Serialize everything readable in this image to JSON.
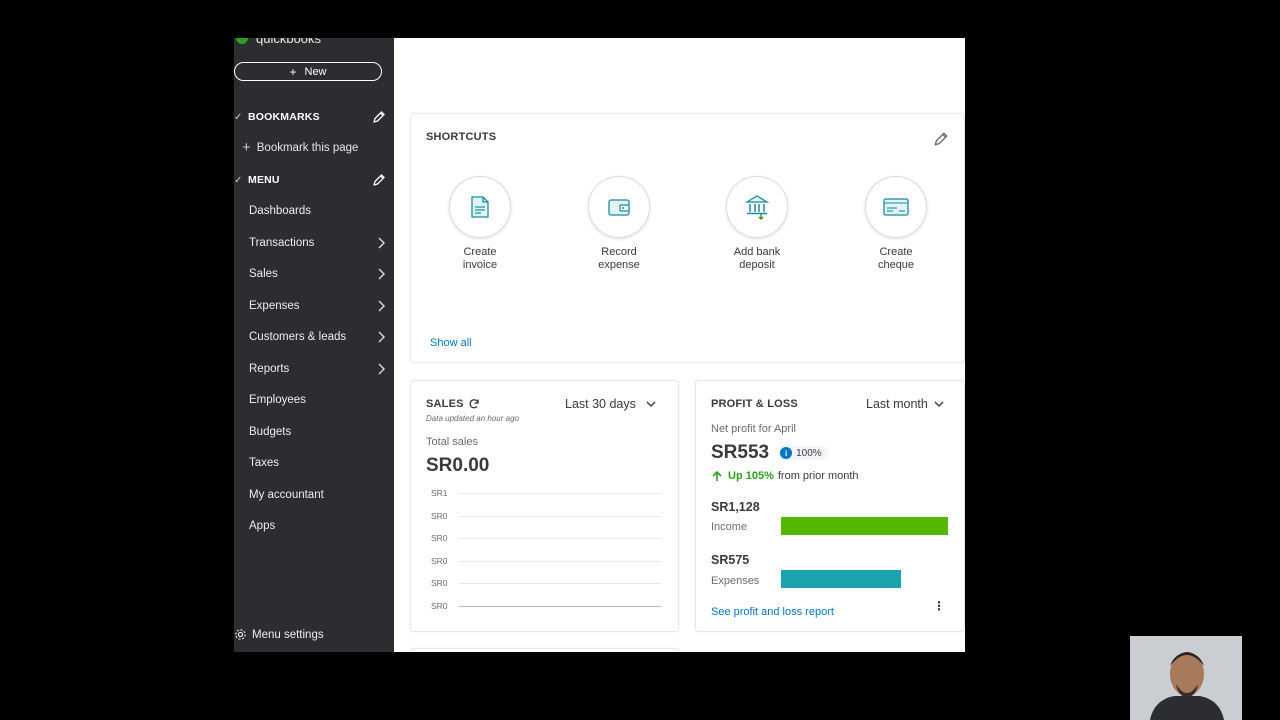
{
  "sidebar": {
    "logo": "quickbooks",
    "new_label": "New",
    "bookmarks_label": "BOOKMARKS",
    "bookmark_this_page": "Bookmark this page",
    "menu_label": "MENU",
    "items": [
      {
        "label": "Dashboards",
        "chevron": false
      },
      {
        "label": "Transactions",
        "chevron": true
      },
      {
        "label": "Sales",
        "chevron": true
      },
      {
        "label": "Expenses",
        "chevron": true
      },
      {
        "label": "Customers & leads",
        "chevron": true
      },
      {
        "label": "Reports",
        "chevron": true
      },
      {
        "label": "Employees",
        "chevron": false
      },
      {
        "label": "Budgets",
        "chevron": false
      },
      {
        "label": "Taxes",
        "chevron": false
      },
      {
        "label": "My accountant",
        "chevron": false
      },
      {
        "label": "Apps",
        "chevron": false
      }
    ],
    "menu_settings": "Menu settings"
  },
  "shortcuts": {
    "title": "SHORTCUTS",
    "items": [
      {
        "label": "Create\ninvoice",
        "icon": "invoice-icon"
      },
      {
        "label": "Record\nexpense",
        "icon": "wallet-icon"
      },
      {
        "label": "Add bank\ndeposit",
        "icon": "bank-icon"
      },
      {
        "label": "Create\ncheque",
        "icon": "cheque-icon"
      }
    ],
    "show_all": "Show all"
  },
  "sales": {
    "title": "SALES",
    "updated": "Data updated an hour ago",
    "period": "Last 30 days",
    "total_label": "Total sales",
    "total_value": "SR0.00",
    "y_labels": [
      "SR1",
      "SR0",
      "SR0",
      "SR0",
      "SR0",
      "SR0"
    ]
  },
  "profit_loss": {
    "title": "PROFIT & LOSS",
    "period": "Last month",
    "net_label": "Net profit for April",
    "net_value": "SR553",
    "badge": "100%",
    "change": "Up 105%",
    "change_suffix": "from prior month",
    "income_value": "SR1,128",
    "income_label": "Income",
    "income_fraction": 1.0,
    "expenses_value": "SR575",
    "expenses_label": "Expenses",
    "expenses_fraction": 0.72,
    "report_link": "See profit and loss report",
    "colors": {
      "income": "#53b700",
      "expenses": "#1ca3b0",
      "up": "#2ca01c"
    }
  }
}
